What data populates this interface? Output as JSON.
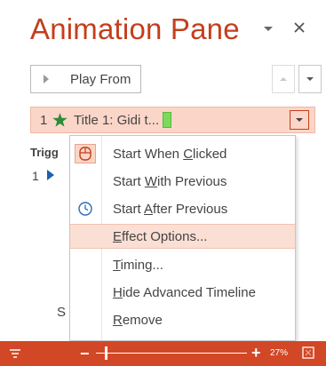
{
  "pane": {
    "title": "Animation Pane",
    "play_label": "Play From"
  },
  "animation_item": {
    "order": "1",
    "label": "Title 1: Gidi t..."
  },
  "trigger": {
    "label": "Trigg",
    "order": "1"
  },
  "peek_text": "S",
  "context_menu": {
    "items": [
      {
        "pre": "Start When ",
        "mnemonic": "C",
        "post": "licked"
      },
      {
        "pre": "Start ",
        "mnemonic": "W",
        "post": "ith Previous"
      },
      {
        "pre": "Start ",
        "mnemonic": "A",
        "post": "fter Previous"
      },
      {
        "pre": "",
        "mnemonic": "E",
        "post": "ffect Options..."
      },
      {
        "pre": "",
        "mnemonic": "T",
        "post": "iming..."
      },
      {
        "pre": "",
        "mnemonic": "H",
        "post": "ide Advanced Timeline"
      },
      {
        "pre": "",
        "mnemonic": "R",
        "post": "emove"
      }
    ]
  },
  "status_bar": {
    "zoom_percent": "27%",
    "zoom_level": 0.27
  },
  "colors": {
    "accent": "#c43e1c",
    "status_bar": "#d24726",
    "selection": "#fbd6c8",
    "star": "#2e8b3a",
    "play_triangle": "#1e5fa8"
  }
}
